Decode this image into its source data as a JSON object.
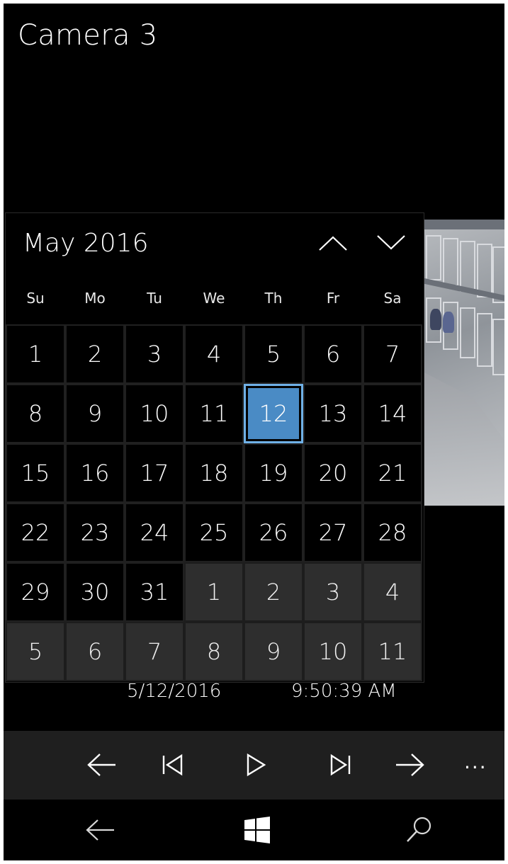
{
  "header": {
    "title": "Camera 3"
  },
  "calendar": {
    "month_label": "May 2016",
    "weekdays": [
      "Su",
      "Mo",
      "Tu",
      "We",
      "Th",
      "Fr",
      "Sa"
    ],
    "weeks": [
      [
        "1",
        "2",
        "3",
        "4",
        "5",
        "6",
        "7"
      ],
      [
        "8",
        "9",
        "10",
        "11",
        "12",
        "13",
        "14"
      ],
      [
        "15",
        "16",
        "17",
        "18",
        "19",
        "20",
        "21"
      ],
      [
        "22",
        "23",
        "24",
        "25",
        "26",
        "27",
        "28"
      ],
      [
        "29",
        "30",
        "31",
        "1",
        "2",
        "3",
        "4"
      ],
      [
        "5",
        "6",
        "7",
        "8",
        "9",
        "10",
        "11"
      ]
    ],
    "selected": "12",
    "accent_color": "#4a8bc5",
    "prev_icon": "chevron-up-icon",
    "next_icon": "chevron-down-icon"
  },
  "playback": {
    "date": "5/12/2016",
    "time": "9:50:39 AM",
    "buttons": [
      "arrow-left-icon",
      "skip-previous-icon",
      "play-icon",
      "skip-next-icon",
      "arrow-right-icon"
    ],
    "more_label": "..."
  },
  "system_nav": {
    "buttons": [
      "back-icon",
      "windows-start-icon",
      "search-icon"
    ]
  }
}
